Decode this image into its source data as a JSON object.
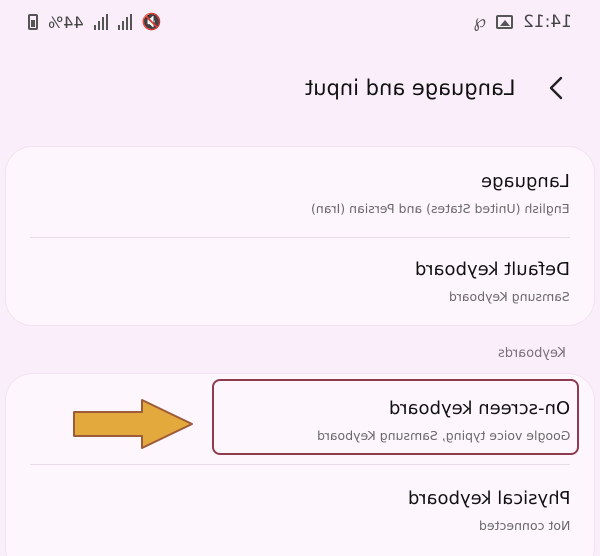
{
  "status_bar": {
    "battery_percent": "44%",
    "time": "14:12"
  },
  "header": {
    "title": "Language and input"
  },
  "settings": {
    "language": {
      "title": "Language",
      "subtitle": "English (United States) and Persian (Iran)"
    },
    "default_keyboard": {
      "title": "Default keyboard",
      "subtitle": "Samsung Keyboard"
    }
  },
  "keyboards_section": {
    "label": "Keyboards",
    "on_screen": {
      "title": "On-screen keyboard",
      "subtitle": "Google voice typing, Samsung Keyboard"
    },
    "physical": {
      "title": "Physical keyboard",
      "subtitle": "Not connected"
    }
  },
  "colors": {
    "background": "#f9eef9",
    "card": "#fdf6fd",
    "highlight_border": "#8e3b4f",
    "arrow_fill": "#e3a93c"
  },
  "icons": {
    "back": "chevron-left-icon",
    "battery": "battery-icon",
    "signal": "signal-bars-icon",
    "mute": "mute-icon",
    "gallery": "image-icon",
    "misc": "notification-icon"
  }
}
